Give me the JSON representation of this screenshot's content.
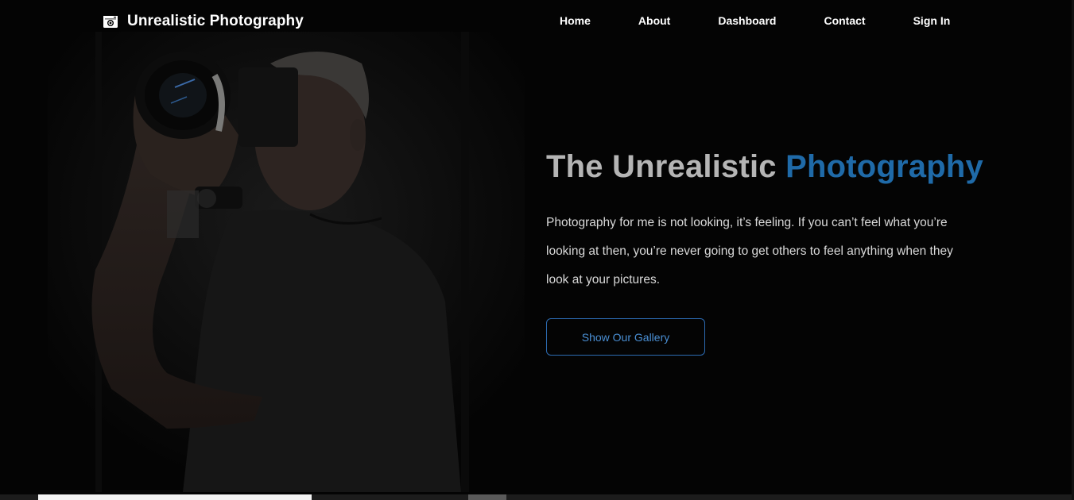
{
  "navbar": {
    "brand_name": "Unrealistic Photography",
    "brand_icon": "camera-icon",
    "links": [
      {
        "label": "Home"
      },
      {
        "label": "About"
      },
      {
        "label": "Dashboard"
      },
      {
        "label": "Contact"
      },
      {
        "label": "Sign In"
      }
    ]
  },
  "hero": {
    "title_part1": "The Unrealistic ",
    "title_accent": "Photography",
    "body": "Photography for me is not looking, it’s feeling. If you can’t feel what you’re looking at then, you’re never going to get others to feel anything when they look at your pictures.",
    "cta_label": "Show Our Gallery",
    "image": "photographer-with-camera"
  },
  "colors": {
    "background": "#040404",
    "accent": "#1f6aa8",
    "title_gray": "#b5b5b5",
    "cta_border": "#2c6bb2"
  }
}
